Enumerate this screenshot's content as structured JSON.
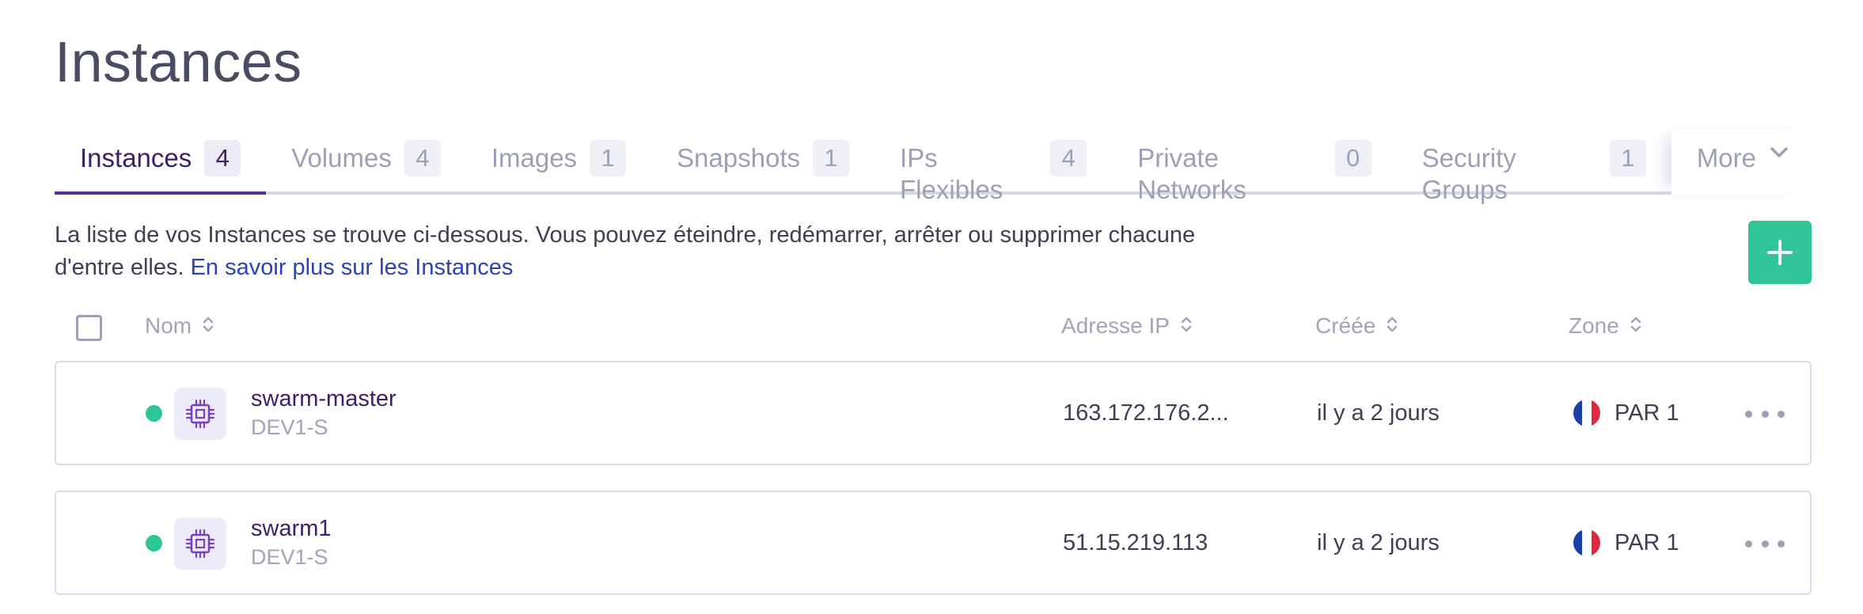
{
  "page": {
    "title": "Instances"
  },
  "tabs": [
    {
      "label": "Instances",
      "count": "4",
      "active": true
    },
    {
      "label": "Volumes",
      "count": "4"
    },
    {
      "label": "Images",
      "count": "1"
    },
    {
      "label": "Snapshots",
      "count": "1"
    },
    {
      "label": "IPs Flexibles",
      "count": "4"
    },
    {
      "label": "Private Networks",
      "count": "0"
    },
    {
      "label": "Security Groups",
      "count": "1"
    }
  ],
  "more_tab": {
    "label": "More"
  },
  "description": {
    "text": "La liste de vos Instances se trouve ci-dessous. Vous pouvez éteindre, redémarrer, arrêter ou supprimer chacune d'entre elles.",
    "link": "En savoir plus sur les Instances"
  },
  "add_button": {
    "symbol": "+"
  },
  "table": {
    "headers": {
      "name": "Nom",
      "ip": "Adresse IP",
      "created": "Créée",
      "zone": "Zone"
    },
    "rows": [
      {
        "name": "swarm-master",
        "type": "DEV1-S",
        "ip": "163.172.176.2...",
        "created": "il y a 2 jours",
        "zone": "PAR 1",
        "status": "running"
      },
      {
        "name": "swarm1",
        "type": "DEV1-S",
        "ip": "51.15.219.113",
        "created": "il y a 2 jours",
        "zone": "PAR 1",
        "status": "running"
      }
    ]
  },
  "colors": {
    "accent": "#5b2b97",
    "link": "#2a43b8",
    "success": "#2fc596",
    "muted": "#9da0b5"
  },
  "icons": {
    "sort": "sort-updown-icon",
    "more": "chevron-down-icon",
    "instance": "cpu-chip-icon",
    "row_actions": "ellipsis-icon",
    "zone_flag": "france-flag-icon"
  }
}
